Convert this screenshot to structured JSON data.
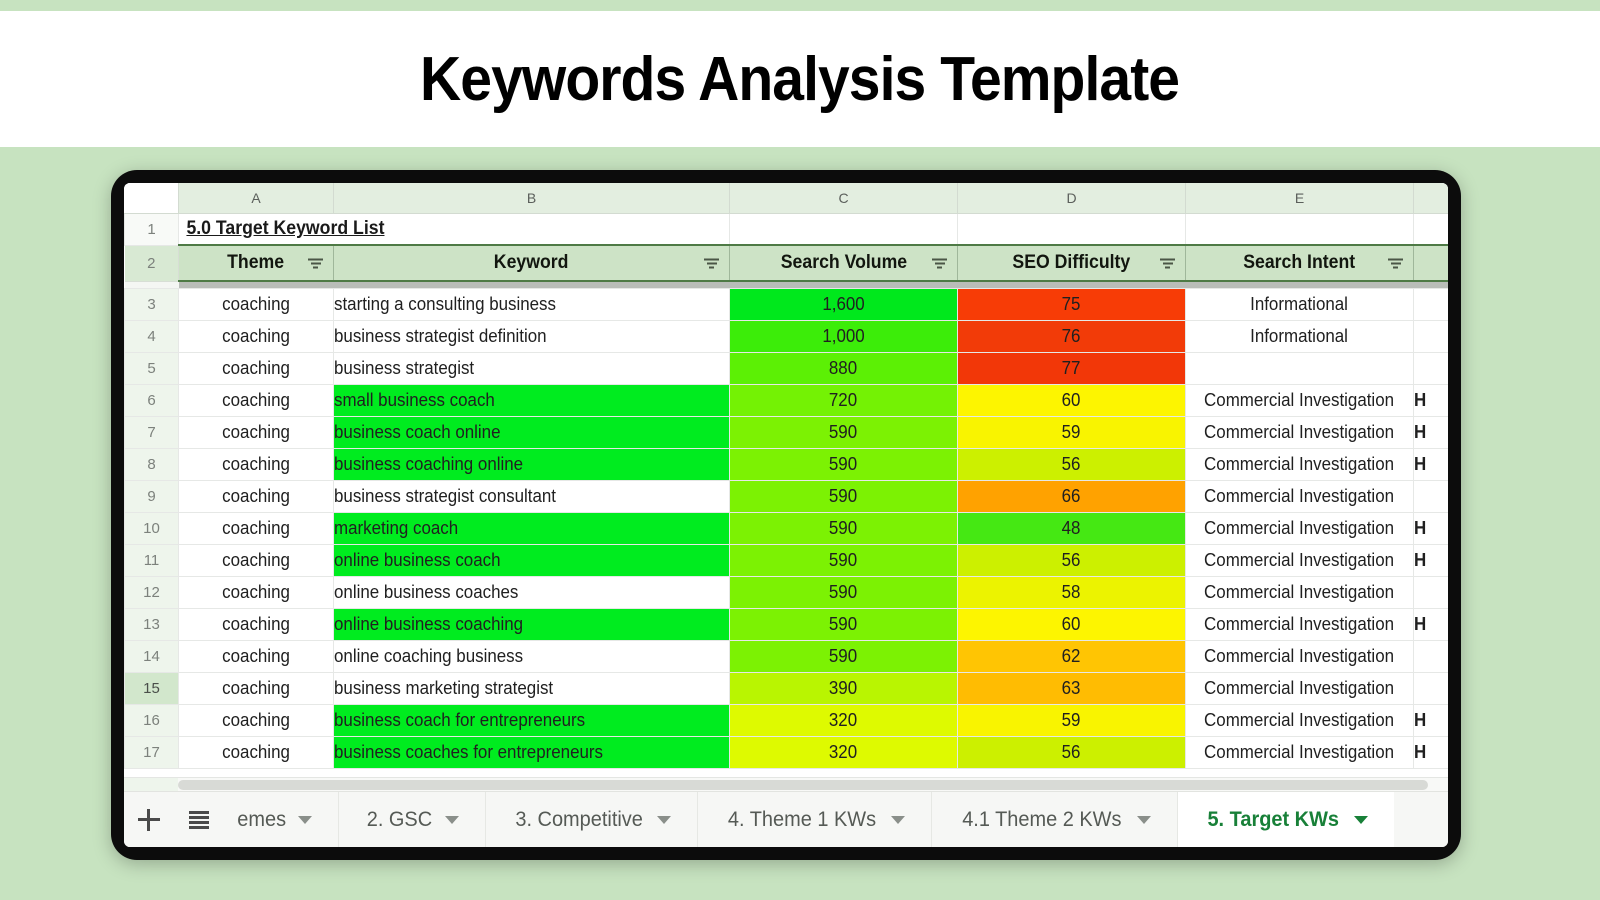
{
  "banner": {
    "title": "Keywords Analysis Template"
  },
  "spreadsheet": {
    "subtitle": "5.0 Target Keyword List",
    "column_letters": [
      "A",
      "B",
      "C",
      "D",
      "E"
    ],
    "headers": [
      "Theme",
      "Keyword",
      "Search Volume",
      "SEO Difficulty",
      "Search Intent"
    ],
    "row_numbers": [
      "1",
      "2",
      "3",
      "4",
      "5",
      "6",
      "7",
      "8",
      "9",
      "10",
      "11",
      "12",
      "13",
      "14",
      "15",
      "16",
      "17"
    ],
    "selected_row": "15",
    "rows": [
      {
        "n": "3",
        "theme": "coaching",
        "keyword": "starting a consulting business",
        "volume": "1,600",
        "difficulty": "75",
        "intent": "Informational",
        "extra": "",
        "kw_bg": "#ffffff",
        "vol_bg": "#00e81c",
        "sd_bg": "#f73c06",
        "intent_bg": "#ffffff"
      },
      {
        "n": "4",
        "theme": "coaching",
        "keyword": "business strategist definition",
        "volume": "1,000",
        "difficulty": "76",
        "intent": "Informational",
        "extra": "",
        "kw_bg": "#ffffff",
        "vol_bg": "#3ced09",
        "sd_bg": "#f23b08",
        "intent_bg": "#ffffff"
      },
      {
        "n": "5",
        "theme": "coaching",
        "keyword": "business strategist",
        "volume": "880",
        "difficulty": "77",
        "intent": "",
        "extra": "",
        "kw_bg": "#ffffff",
        "vol_bg": "#5cf005",
        "sd_bg": "#f23708",
        "intent_bg": "#ffffff"
      },
      {
        "n": "6",
        "theme": "coaching",
        "keyword": "small business coach",
        "volume": "720",
        "difficulty": "60",
        "intent": "Commercial Investigation",
        "extra": "H",
        "kw_bg": "#00ec1f",
        "vol_bg": "#74f204",
        "sd_bg": "#fdf500",
        "intent_bg": "#ffffff"
      },
      {
        "n": "7",
        "theme": "coaching",
        "keyword": "business coach online",
        "volume": "590",
        "difficulty": "59",
        "intent": "Commercial Investigation",
        "extra": "H",
        "kw_bg": "#00ec1f",
        "vol_bg": "#7cf203",
        "sd_bg": "#f9f400",
        "intent_bg": "#ffffff"
      },
      {
        "n": "8",
        "theme": "coaching",
        "keyword": "business coaching online",
        "volume": "590",
        "difficulty": "56",
        "intent": "Commercial Investigation",
        "extra": "H",
        "kw_bg": "#00ec1f",
        "vol_bg": "#7cf203",
        "sd_bg": "#ccf000",
        "intent_bg": "#ffffff"
      },
      {
        "n": "9",
        "theme": "coaching",
        "keyword": "business strategist consultant",
        "volume": "590",
        "difficulty": "66",
        "intent": "Commercial Investigation",
        "extra": "",
        "kw_bg": "#ffffff",
        "vol_bg": "#7cf203",
        "sd_bg": "#ffa200",
        "intent_bg": "#ffffff"
      },
      {
        "n": "10",
        "theme": "coaching",
        "keyword": "marketing coach",
        "volume": "590",
        "difficulty": "48",
        "intent": "Commercial Investigation",
        "extra": "H",
        "kw_bg": "#00ec1f",
        "vol_bg": "#7cf203",
        "sd_bg": "#45e813",
        "intent_bg": "#ffffff"
      },
      {
        "n": "11",
        "theme": "coaching",
        "keyword": "online business coach",
        "volume": "590",
        "difficulty": "56",
        "intent": "Commercial Investigation",
        "extra": "H",
        "kw_bg": "#00ec1f",
        "vol_bg": "#7cf203",
        "sd_bg": "#ccf000",
        "intent_bg": "#ffffff"
      },
      {
        "n": "12",
        "theme": "coaching",
        "keyword": "online business coaches",
        "volume": "590",
        "difficulty": "58",
        "intent": "Commercial Investigation",
        "extra": "",
        "kw_bg": "#ffffff",
        "vol_bg": "#7cf203",
        "sd_bg": "#ecf300",
        "intent_bg": "#ffffff"
      },
      {
        "n": "13",
        "theme": "coaching",
        "keyword": "online business coaching",
        "volume": "590",
        "difficulty": "60",
        "intent": "Commercial Investigation",
        "extra": "H",
        "kw_bg": "#00ec1f",
        "vol_bg": "#7cf203",
        "sd_bg": "#fdf500",
        "intent_bg": "#ffffff"
      },
      {
        "n": "14",
        "theme": "coaching",
        "keyword": "online coaching business",
        "volume": "590",
        "difficulty": "62",
        "intent": "Commercial Investigation",
        "extra": "",
        "kw_bg": "#ffffff",
        "vol_bg": "#7cf203",
        "sd_bg": "#ffc503",
        "intent_bg": "#ffffff"
      },
      {
        "n": "15",
        "theme": "coaching",
        "keyword": "business marketing strategist",
        "volume": "390",
        "difficulty": "63",
        "intent": "Commercial Investigation",
        "extra": "",
        "kw_bg": "#ffffff",
        "vol_bg": "#b9f501",
        "sd_bg": "#ffbc02",
        "intent_bg": "#ffffff"
      },
      {
        "n": "16",
        "theme": "coaching",
        "keyword": "business coach for entrepreneurs",
        "volume": "320",
        "difficulty": "59",
        "intent": "Commercial Investigation",
        "extra": "H",
        "kw_bg": "#00ec1f",
        "vol_bg": "#defa00",
        "sd_bg": "#f9f400",
        "intent_bg": "#ffffff"
      },
      {
        "n": "17",
        "theme": "coaching",
        "keyword": "business coaches for entrepreneurs",
        "volume": "320",
        "difficulty": "56",
        "intent": "Commercial Investigation",
        "extra": "H",
        "kw_bg": "#00ec1f",
        "vol_bg": "#defa00",
        "sd_bg": "#ccf000",
        "intent_bg": "#ffffff"
      }
    ]
  },
  "tabbar": {
    "add_sheet_label": "+",
    "all_sheets_label": "All sheets",
    "tabs": [
      {
        "label": "emes",
        "active": false
      },
      {
        "label": "2. GSC",
        "active": false
      },
      {
        "label": "3. Competitive",
        "active": false
      },
      {
        "label": "4. Theme 1 KWs",
        "active": false
      },
      {
        "label": "4.1 Theme 2 KWs",
        "active": false
      },
      {
        "label": "5. Target KWs",
        "active": true
      }
    ]
  },
  "colors": {
    "page_background": "#c7e3c0",
    "banner_background": "#ffffff",
    "device_frame": "#0c0c0c",
    "header_green": "#cde3c6",
    "active_tab_text": "#188038"
  }
}
